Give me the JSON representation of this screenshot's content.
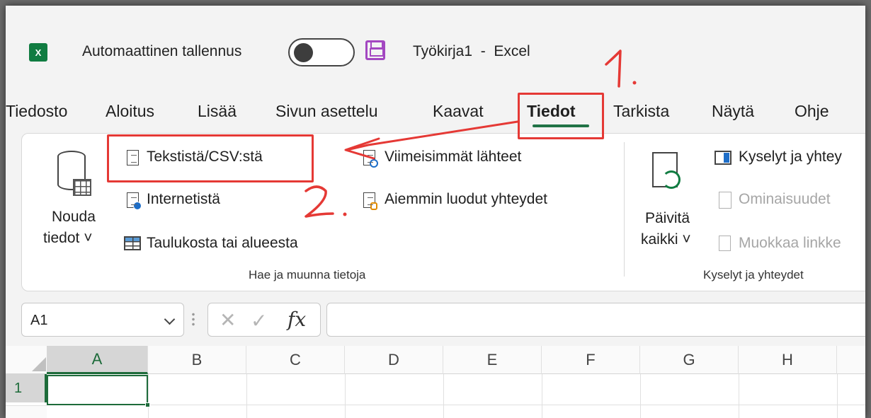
{
  "titlebar": {
    "app_icon_letter": "X",
    "autosave_label": "Automaattinen tallennus",
    "doc_title": "Työkirja1  -  Excel"
  },
  "tabs": [
    {
      "label": "Tiedosto",
      "active": false
    },
    {
      "label": "Aloitus",
      "active": false
    },
    {
      "label": "Lisää",
      "active": false
    },
    {
      "label": "Sivun asettelu",
      "active": false
    },
    {
      "label": "Kaavat",
      "active": false
    },
    {
      "label": "Tiedot",
      "active": true
    },
    {
      "label": "Tarkista",
      "active": false
    },
    {
      "label": "Näytä",
      "active": false
    },
    {
      "label": "Ohje",
      "active": false
    }
  ],
  "ribbon": {
    "get_data": {
      "line1": "Nouda",
      "line2": "tiedot ˅"
    },
    "from_text_csv": "Tekstistä/CSV:stä",
    "from_web": "Internetistä",
    "from_table": "Taulukosta tai alueesta",
    "recent_sources": "Viimeisimmät lähteet",
    "existing_connections": "Aiemmin luodut yhteydet",
    "group1_label": "Hae ja muunna tietoja",
    "refresh_all": {
      "line1": "Päivitä",
      "line2": "kaikki ˅"
    },
    "queries_connections": "Kyselyt ja yhtey",
    "properties": "Ominaisuudet",
    "edit_links": "Muokkaa linkke",
    "group2_label": "Kyselyt ja yhteydet"
  },
  "formula_bar": {
    "name_box": "A1",
    "cancel": "✕",
    "enter": "✓",
    "fx": "fx",
    "formula": ""
  },
  "grid": {
    "columns": [
      "A",
      "B",
      "C",
      "D",
      "E",
      "F",
      "G",
      "H"
    ],
    "rows": [
      "1"
    ],
    "active_cell": "A1"
  },
  "annotations": {
    "step1": "1.",
    "step2": "2."
  },
  "colors": {
    "excel_green": "#107c41",
    "annotation_red": "#e53935",
    "save_purple": "#a347c1"
  }
}
